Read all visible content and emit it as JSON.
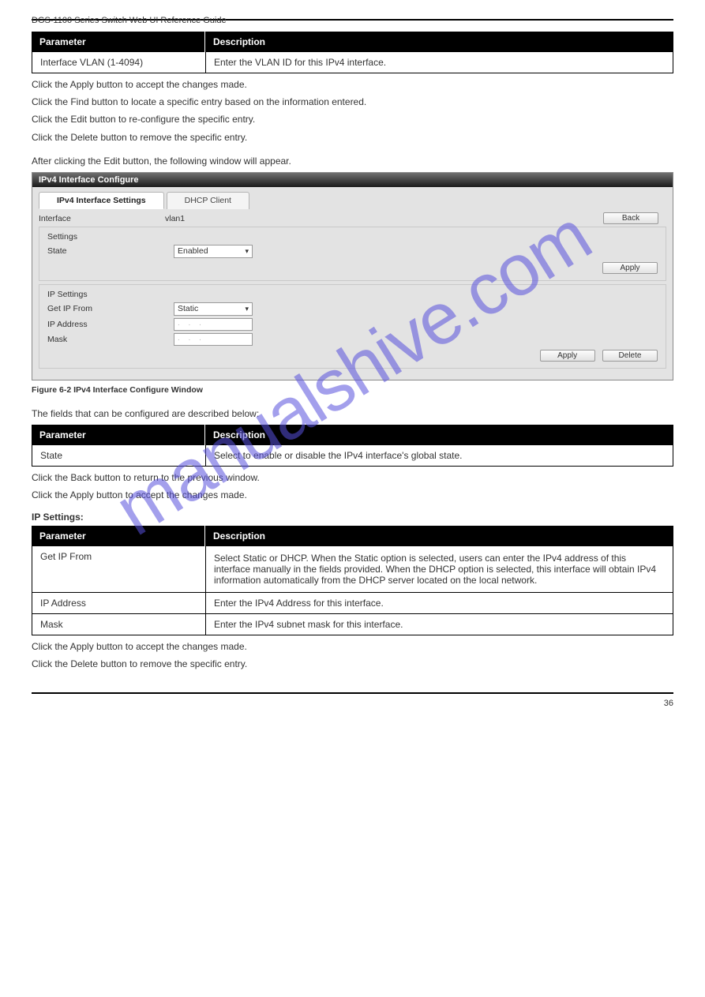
{
  "watermark": "manualshive.com",
  "header": {
    "left": "DGS-1100 Series Switch Web UI Reference Guide",
    "right": ""
  },
  "table1": {
    "h1": "Parameter",
    "h2": "Description",
    "row1": {
      "name": "Interface VLAN (1-4094)",
      "desc": "Enter the VLAN ID for this IPv4 interface."
    }
  },
  "para_after_t1_1": "Click the Apply button to accept the changes made.",
  "para_after_t1_2": "Click the Find button to locate a specific entry based on the information entered.",
  "para_after_t1_3": "Click the Edit button to re-configure the specific entry.",
  "para_after_t1_4": "Click the Delete button to remove the specific entry.",
  "para_edit_intro": "After clicking the Edit button, the following window will appear.",
  "screenshot": {
    "title": "IPv4 Interface Configure",
    "tabs": {
      "active": "IPv4 Interface Settings",
      "other": "DHCP Client"
    },
    "top": {
      "interface_label": "Interface",
      "interface_value": "vlan1",
      "back_btn": "Back"
    },
    "settings": {
      "title": "Settings",
      "state_label": "State",
      "state_value": "Enabled",
      "apply_btn": "Apply"
    },
    "ip": {
      "title": "IP Settings",
      "getip_label": "Get IP From",
      "getip_value": "Static",
      "ipaddr_label": "IP Address",
      "ipaddr_value": ". . .",
      "mask_label": "Mask",
      "mask_value": ". . .",
      "apply_btn": "Apply",
      "delete_btn": "Delete"
    }
  },
  "figcaption": "Figure 6-2 IPv4 Interface Configure Window",
  "para_fields_intro": "The fields that can be configured are described below:",
  "table2": {
    "h1": "Parameter",
    "h2": "Description",
    "row1": {
      "name": "State",
      "desc": "Select to enable or disable the IPv4 interface's global state."
    }
  },
  "para_after_t2_1": "Click the Back button to return to the previous window.",
  "para_after_t2_2": "Click the Apply button to accept the changes made.",
  "section_ip": "IP Settings:",
  "table3": {
    "h1": "Parameter",
    "h2": "Description",
    "row1": {
      "name": "Get IP From",
      "desc1": "Select Static or DHCP. When the Static option is selected, users can enter the IPv4 address of this interface manually in the fields provided. When the DHCP option is selected, this interface will obtain IPv4 information automatically from the DHCP server located on the local network."
    },
    "row2": {
      "name": "IP Address",
      "desc": "Enter the IPv4 Address for this interface."
    },
    "row3": {
      "name": "Mask",
      "desc": "Enter the IPv4 subnet mask for this interface."
    }
  },
  "para_after_t3_1": "Click the Apply button to accept the changes made.",
  "para_after_t3_2": "Click the Delete button to remove the specific entry.",
  "footer": {
    "left": "",
    "right": "36"
  }
}
